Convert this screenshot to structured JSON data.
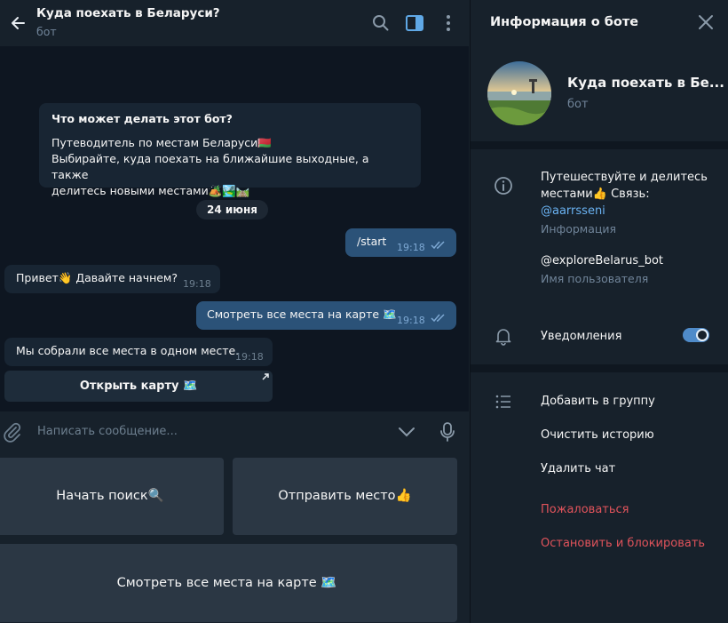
{
  "header": {
    "title": "Куда поехать в Беларуси?",
    "subtitle": "бот"
  },
  "messages": {
    "info_title": "Что может делать этот бот?",
    "info_line1": "Путеводитель по местам Беларуси🇧🇾",
    "info_line2": "Выбирайте, куда поехать на ближайшие выходные, а также",
    "info_line3": "делитесь новыми местами🏕️🏞️🛤️",
    "date": "24 июня",
    "m1_text": "/start",
    "m1_time": "19:18",
    "m2_text": "Привет👋 Давайте начнем?",
    "m2_time": "19:18",
    "m3_text": "Смотреть все места на карте 🗺️",
    "m3_time": "19:18",
    "m4_text": "Мы собрали все места в одном месте.",
    "m4_time": "19:18",
    "inline_button": "Открыть карту 🗺️"
  },
  "input": {
    "placeholder": "Написать сообщение..."
  },
  "keyboard": {
    "btn1": "Начать поиск🔍",
    "btn2": "Отправить место👍",
    "btn3": "Смотреть все места на карте 🗺️"
  },
  "side": {
    "title": "Информация о боте",
    "bot_name": "Куда поехать в Бе...",
    "bot_type": "бот",
    "about_line1": "Путешествуйте и делитесь",
    "about_line2": "местами👍 Связь:",
    "about_link": "@aarrsseni",
    "about_label": "Информация",
    "username": "@exploreBelarus_bot",
    "username_label": "Имя пользователя",
    "notifications": "Уведомления",
    "add_group": "Добавить в группу",
    "clear_history": "Очистить историю",
    "delete_chat": "Удалить чат",
    "report": "Пожаловаться",
    "block": "Остановить и блокировать"
  },
  "colors": {
    "accent": "#6ab2f2",
    "danger": "#e0535b",
    "outgoing": "#2b5278",
    "incoming": "#182533"
  }
}
